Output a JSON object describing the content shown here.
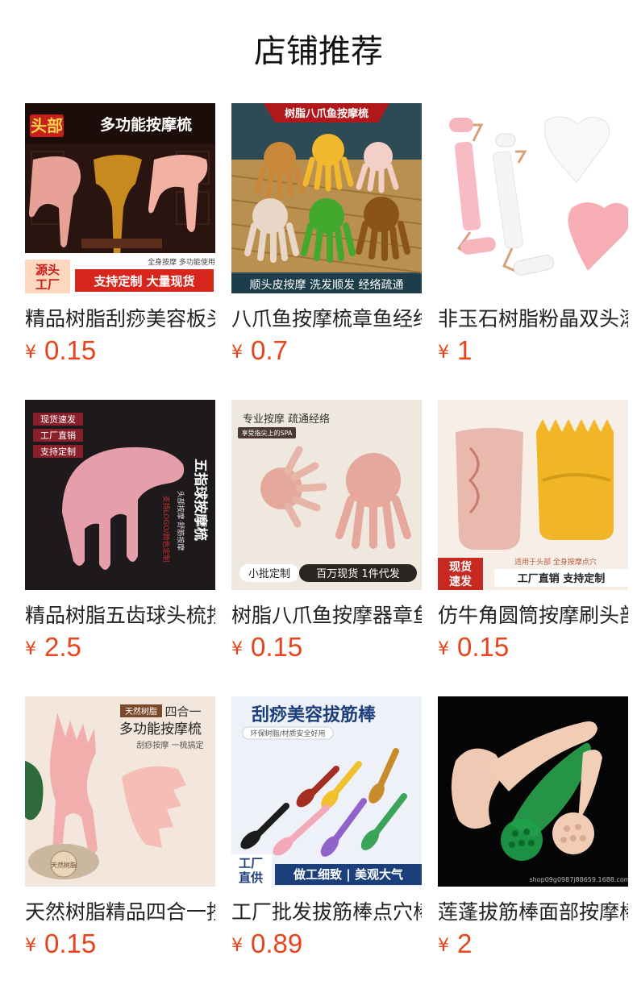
{
  "page": {
    "title": "店铺推荐"
  },
  "currency": "¥",
  "products": [
    {
      "name": "精品树脂刮痧美容板头部多功能按摩梳",
      "price": "0.15",
      "image": {
        "banner": "头部",
        "headline": "多功能按摩梳",
        "corner": "源头工厂",
        "corner_1": "源头",
        "corner_2": "工厂",
        "strip_small": "全身按摩  多功能使用",
        "strip": "支持定制 大量现货"
      }
    },
    {
      "name": "八爪鱼按摩梳章鱼经络梳",
      "price": "0.7",
      "image": {
        "banner": "树脂八爪鱼按摩梳",
        "strip": "顺头皮按摩 洗发顺发 经络疏通"
      }
    },
    {
      "name": "非玉石树脂粉晶双头滚轮",
      "price": "1",
      "image": {}
    },
    {
      "name": "精品树脂五齿球头梳按摩梳",
      "price": "2.5",
      "image": {
        "tags": [
          "现货速发",
          "工厂直销",
          "支持定制"
        ],
        "vertical": "五指球按摩梳",
        "sub": "头部按摩·舒筋按摩",
        "stamp": "支持LOGO/颜色定制"
      }
    },
    {
      "name": "树脂八爪鱼按摩器章鱼头部",
      "price": "0.15",
      "image": {
        "headline": "专业按摩 疏通经络",
        "sub": "享受指尖上的SPA",
        "tag_left": "小批定制",
        "tag_right": "百万现货 1件代发"
      }
    },
    {
      "name": "仿牛角圆筒按摩刷头部穴位",
      "price": "0.15",
      "image": {
        "badge": "现货速发",
        "badge_1": "现货",
        "badge_2": "速发",
        "note": "适用于头部 全身按摩点穴",
        "strip": "工厂直销 支持定制"
      }
    },
    {
      "name": "天然树脂精品四合一按摩梳",
      "price": "0.15",
      "image": {
        "label": "天然树脂",
        "title_small": "四合一",
        "headline": "多功能按摩梳",
        "sub": "刮痧按摩 一梳搞定",
        "seal": "天然树脂"
      }
    },
    {
      "name": "工厂批发拔筋棒点穴棒",
      "price": "0.89",
      "image": {
        "headline": "刮痧美容拔筋棒",
        "sub": "环保树脂/材质安全好用",
        "corner": "工厂直供",
        "corner_1": "工厂",
        "corner_2": "直供",
        "strip": "做工细致 | 美观大气"
      }
    },
    {
      "name": "莲蓬拔筋棒面部按摩棒",
      "price": "2",
      "image": {
        "watermark": "shop09g0987j88659.1688.com"
      }
    }
  ],
  "colors": {
    "price": "#e8431b",
    "title": "#111111",
    "text": "#222222"
  }
}
